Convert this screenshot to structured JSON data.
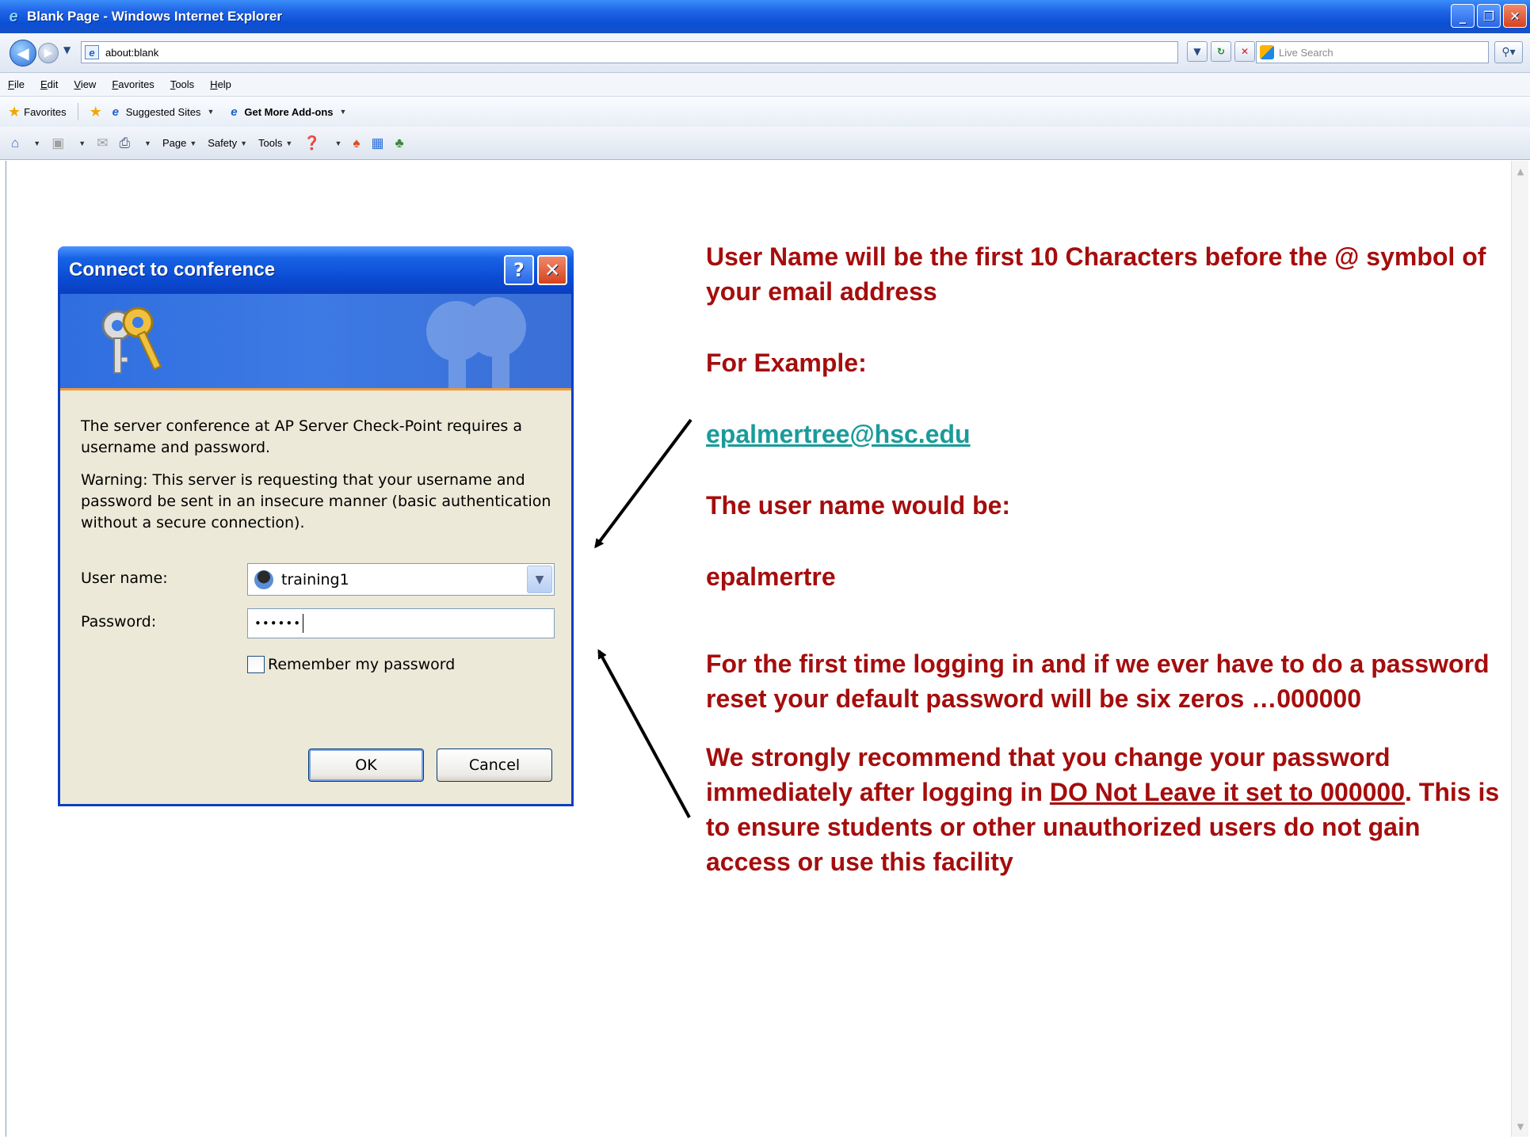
{
  "window": {
    "title": "Blank Page - Windows Internet Explorer",
    "controls": [
      "minimize-icon",
      "restore-icon",
      "close-icon"
    ]
  },
  "address": {
    "url": "about:blank",
    "search_placeholder": "Live Search"
  },
  "menu": {
    "items": [
      "File",
      "Edit",
      "View",
      "Favorites",
      "Tools",
      "Help"
    ]
  },
  "favorites_bar": {
    "favorites_label": "Favorites",
    "suggested_sites": "Suggested Sites",
    "get_more_addons": "Get More Add-ons"
  },
  "command_bar": {
    "page": "Page",
    "safety": "Safety",
    "tools": "Tools"
  },
  "dialog": {
    "title": "Connect to conference",
    "message": "The server conference at AP Server Check-Point requires a username and password.",
    "warning": "Warning: This server is requesting that your username and password be sent in an insecure manner (basic authentication without a secure connection).",
    "username_label": "User name:",
    "username_value": "training1",
    "password_label": "Password:",
    "password_value": "••••••",
    "remember_label": "Remember my password",
    "remember_checked": false,
    "ok_label": "OK",
    "cancel_label": "Cancel"
  },
  "instructions": {
    "line1": "User Name will be the first 10 Characters before the @ symbol of your email address",
    "line2": "For Example:",
    "email": "epalmertree@hsc.edu",
    "line3": "The user name would be:",
    "username_example": "epalmertre",
    "line4": "For the first time logging in and if we ever have to do a password reset your default password will be six zeros …000000",
    "line5_start": "We strongly recommend that you change your password immediately after logging in ",
    "line5_underlined": "DO Not Leave it set to 000000",
    "line5_end": ".  This is to ensure students or other unauthorized users do not gain access or use this facility"
  },
  "colors": {
    "instruction_text": "#a50d0d",
    "email_link": "#1a9b9b",
    "xp_titlebar": "#0a4ad2",
    "dialog_bg": "#ece9d8"
  }
}
